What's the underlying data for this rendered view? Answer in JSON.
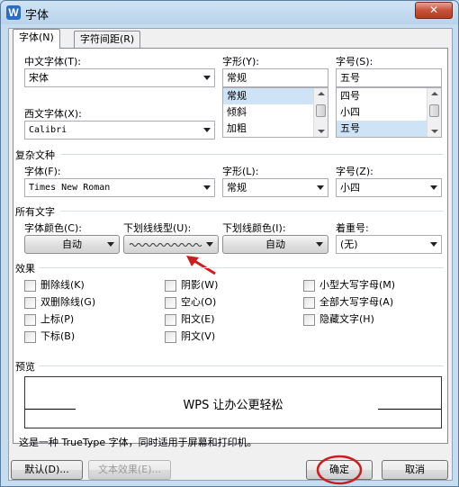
{
  "window": {
    "title": "字体",
    "app_icon": "W",
    "close": "✕"
  },
  "tabs": [
    {
      "label": "字体(N)"
    },
    {
      "label": "字符间距(R)"
    }
  ],
  "chinese_font": {
    "label": "中文字体(T):",
    "value": "宋体"
  },
  "western_font": {
    "label": "西文字体(X):",
    "value": "Calibri"
  },
  "style": {
    "label": "字形(Y):",
    "value": "常规",
    "options": [
      "常规",
      "倾斜",
      "加粗"
    ]
  },
  "size": {
    "label": "字号(S):",
    "value": "五号",
    "options": [
      "四号",
      "小四",
      "五号"
    ]
  },
  "complex": {
    "header": "复杂文种",
    "font_label": "字体(F):",
    "font_value": "Times New Roman",
    "style_label": "字形(L):",
    "style_value": "常规",
    "size_label": "字号(Z):",
    "size_value": "小四"
  },
  "all_text": {
    "header": "所有文字",
    "color_label": "字体颜色(C):",
    "color_value": "自动",
    "underline_type_label": "下划线线型(U):",
    "underline_color_label": "下划线颜色(I):",
    "underline_color_value": "自动",
    "emphasis_label": "着重号:",
    "emphasis_value": "(无)"
  },
  "effects": {
    "header": "效果",
    "col1": [
      "删除线(K)",
      "双删除线(G)",
      "上标(P)",
      "下标(B)"
    ],
    "col2": [
      "阴影(W)",
      "空心(O)",
      "阳文(E)",
      "阴文(V)"
    ],
    "col3": [
      "小型大写字母(M)",
      "全部大写字母(A)",
      "隐藏文字(H)"
    ]
  },
  "preview": {
    "header": "预览",
    "sample": "WPS 让办公更轻松",
    "note": "这是一种 TrueType 字体，同时适用于屏幕和打印机。"
  },
  "buttons": {
    "default": "默认(D)...",
    "text_effects": "文本效果(E)...",
    "ok": "确定",
    "cancel": "取消"
  },
  "annotation_color": "#cc1e1e"
}
